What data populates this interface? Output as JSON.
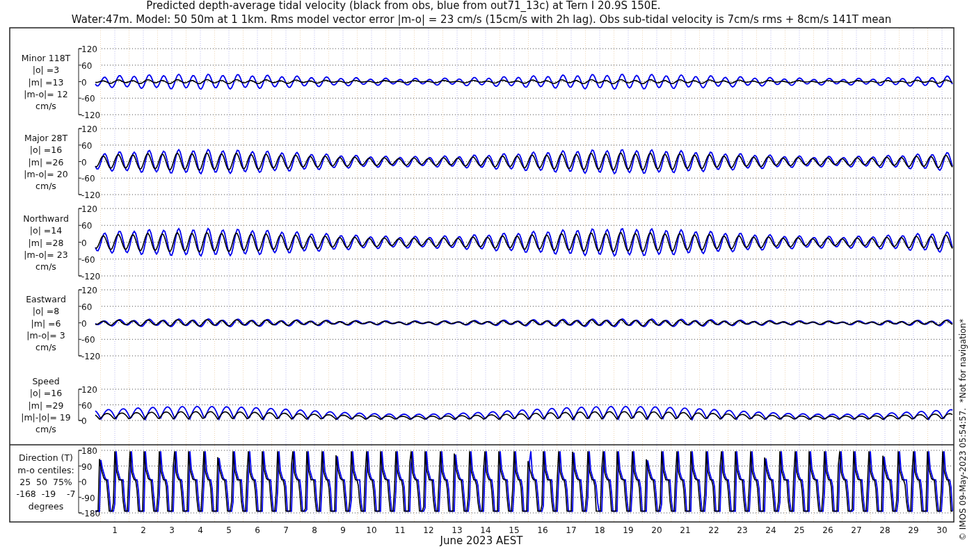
{
  "title_lines": [
    "Predicted depth-average tidal velocity (black from obs, blue from out71_13c) at Tern I 20.9S 150E.",
    "Water:47m. Model: 50 50m at 1 1km. Rms model vector error |m-o| = 23 cm/s (15cm/s with 2h lag). Obs sub-tidal velocity is 7cm/s rms + 8cm/s 141T mean"
  ],
  "panels": [
    {
      "kind": "tidal",
      "label_lines": [
        "Minor 118T",
        "|o| =3",
        "|m| =13",
        "|m-o|= 12",
        "cm/s"
      ],
      "y_ticks": [
        "120",
        "60",
        "0",
        "-60",
        "-120"
      ]
    },
    {
      "kind": "tidal",
      "label_lines": [
        "Major 28T",
        "|o| =16",
        "|m| =26",
        "|m-o|= 20",
        "cm/s"
      ],
      "y_ticks": [
        "120",
        "60",
        "0",
        "-60",
        "-120"
      ]
    },
    {
      "kind": "tidal",
      "label_lines": [
        "Northward",
        "|o| =14",
        "|m| =28",
        "|m-o|= 23",
        "cm/s"
      ],
      "y_ticks": [
        "120",
        "60",
        "0",
        "-60",
        "-120"
      ]
    },
    {
      "kind": "tidal",
      "label_lines": [
        "Eastward",
        "|o| =8",
        "|m| =6",
        "|m-o|= 3",
        "cm/s"
      ],
      "y_ticks": [
        "120",
        "60",
        "0",
        "-60",
        "-120"
      ]
    },
    {
      "kind": "speed",
      "label_lines": [
        "Speed",
        "|o| =16",
        "|m| =29",
        "|m|-|o|= 19",
        "cm/s"
      ],
      "y_ticks": [
        "120",
        "60",
        "0"
      ]
    },
    {
      "kind": "direction",
      "label_lines": [
        "Direction (T)",
        "m-o centiles:",
        "25  50  75%",
        "-168  -19    -7",
        "degrees"
      ],
      "y_ticks": [
        "180",
        "90",
        "0",
        "-90",
        "-180"
      ]
    }
  ],
  "x_ticks": [
    "1",
    "2",
    "3",
    "4",
    "5",
    "6",
    "7",
    "8",
    "9",
    "10",
    "11",
    "12",
    "13",
    "14",
    "15",
    "16",
    "17",
    "18",
    "19",
    "20",
    "21",
    "22",
    "23",
    "24",
    "25",
    "26",
    "27",
    "28",
    "29",
    "30"
  ],
  "x_label": "June 2023 AEST",
  "side_note": "© IMOS 09-May-2023 05:54:57.  *Not for navigation*"
}
